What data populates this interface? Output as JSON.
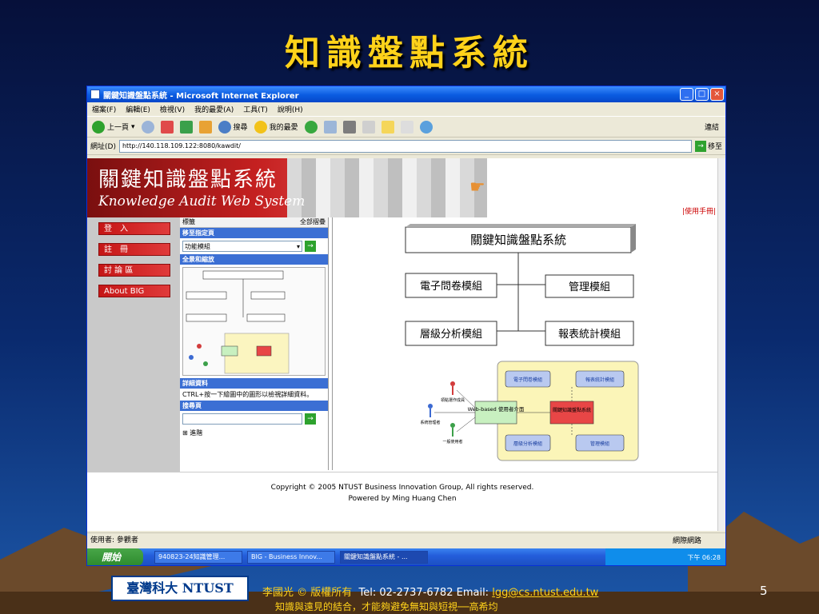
{
  "slide": {
    "title": "知識盤點系統",
    "credit_name": "李國光  © 版權所有",
    "credit_tel": "Tel: 02-2737-6782  Email:",
    "credit_email": "lgg@cs.ntust.edu.tw",
    "quote": "知識與遠見的結合，才能夠避免無知與短視──高希均",
    "page_number": "5",
    "logo_text": "臺灣科大 NTUST"
  },
  "window": {
    "title": "關鍵知識盤點系統 - Microsoft Internet Explorer",
    "menu": [
      "檔案(F)",
      "編輯(E)",
      "檢視(V)",
      "我的最愛(A)",
      "工具(T)",
      "說明(H)"
    ],
    "toolbar": {
      "back": "上一頁",
      "search": "搜尋",
      "favorites": "我的最愛",
      "links": "連結"
    },
    "address_label": "網址(D)",
    "address": "http://140.118.109.122:8080/kawdit/",
    "go": "移至"
  },
  "site": {
    "banner_title": "關鍵知識盤點系統",
    "banner_subtitle": "Knowledge Audit Web System",
    "manual": "|使用手冊|",
    "nav": [
      "登　入",
      "註　冊",
      "討 論 區",
      "About BIG"
    ],
    "sidepane": {
      "head_left": "標籤",
      "head_right": "全部摺疊",
      "sec_goto": "移至指定頁",
      "select_value": "功能模組",
      "sec_overview": "全景和縮放",
      "sec_detail": "詳細資料",
      "detail_text": "CTRL+按一下繪圖中的圖形以檢視詳細資料。",
      "sec_search": "搜尋頁",
      "advanced": "⊞ 進階"
    },
    "diagram": {
      "root": "關鍵知識盤點系統",
      "left_top": "電子問卷模組",
      "left_bottom": "層級分析模組",
      "right_top": "管理模組",
      "right_bottom": "報表統計模組",
      "small": {
        "center_left": "Web-based 使用者介面",
        "center_right": "關鍵知識盤點系統",
        "tl": "電子問卷模組",
        "tr": "報表統計模組",
        "bl": "層級分析模組",
        "br": "管理模組",
        "actor1": "領點選作成員",
        "actor2": "系統管理者",
        "actor3": "一般使用者"
      }
    },
    "footer_line1": "Copyright © 2005 NTUST Business Innovation Group, All rights reserved.",
    "footer_line2": "Powered by Ming Huang Chen"
  },
  "status": {
    "left": "使用者: 參觀者",
    "zone": "網際網路"
  },
  "taskbar": {
    "start": "開始",
    "tasks": [
      "940823-24知識管理...",
      "BIG - Business Innov...",
      "關鍵知識盤點系統 - ..."
    ],
    "clock": "下午 06:28"
  }
}
